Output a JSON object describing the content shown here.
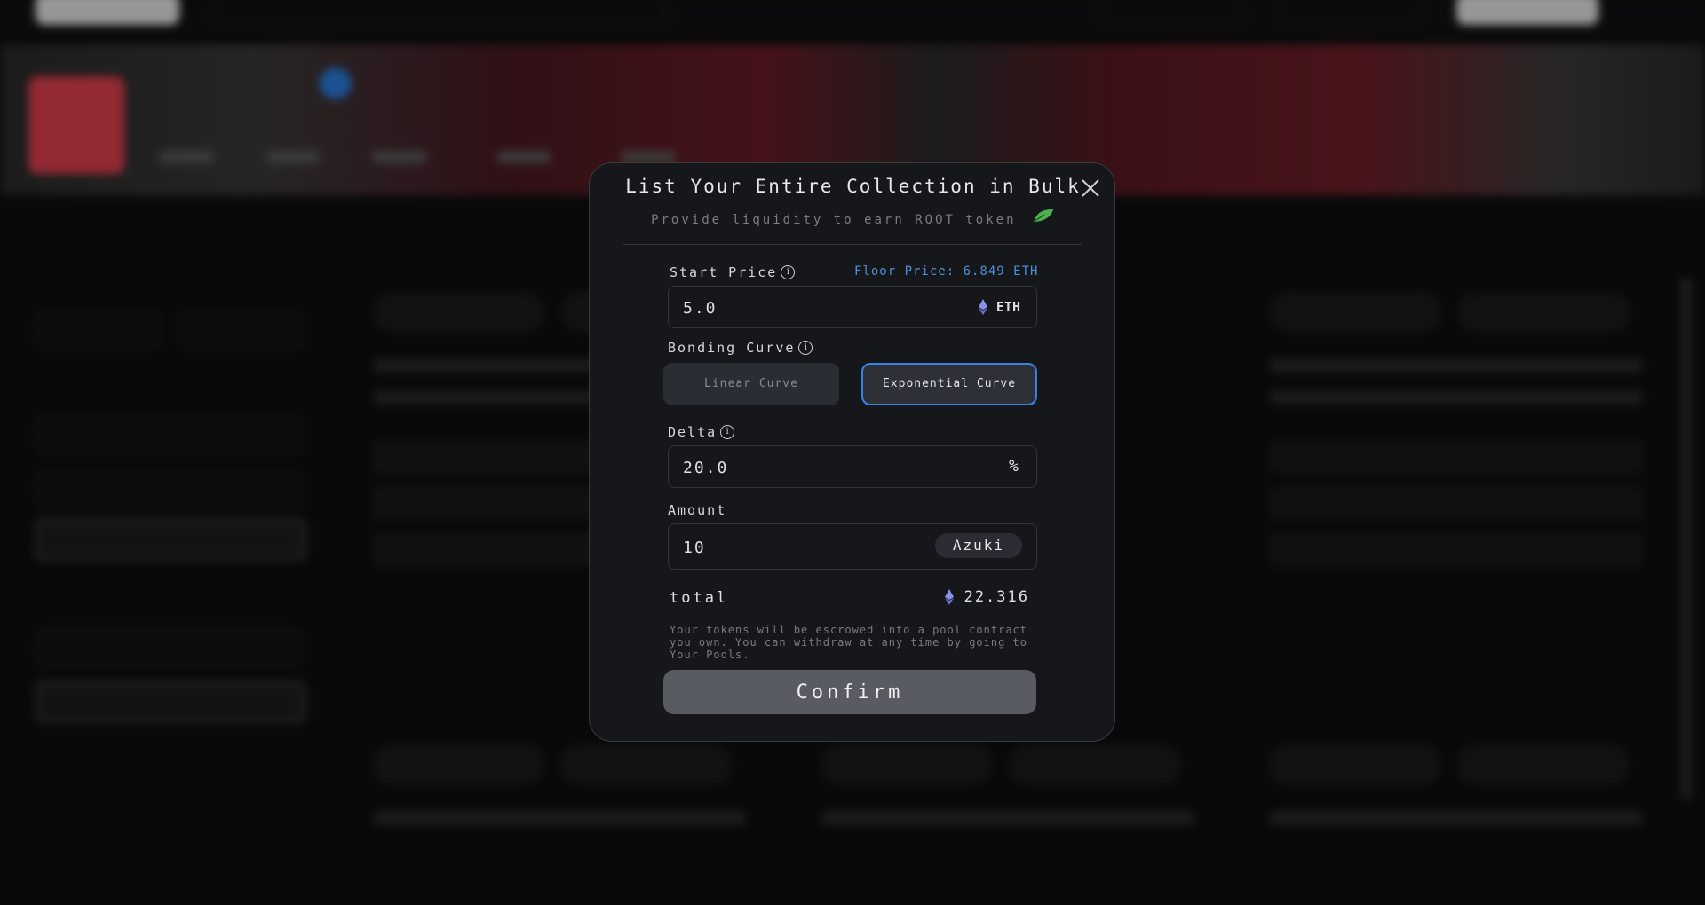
{
  "modal": {
    "title": "List Your Entire Collection in Bulk",
    "subtitle": "Provide liquidity to earn ROOT token",
    "leaf_icon": "leaf-icon",
    "close_icon": "close-icon",
    "start_price": {
      "label": "Start Price",
      "info_icon": "info-icon",
      "floor_label": "Floor Price: 6.849 ETH",
      "value": "5.0",
      "unit": "ETH",
      "unit_icon": "ethereum-icon"
    },
    "bonding_curve": {
      "label": "Bonding Curve",
      "options": [
        "Linear Curve",
        "Exponential Curve"
      ],
      "selected": "Exponential Curve"
    },
    "delta": {
      "label": "Delta",
      "value": "20.0",
      "unit": "%"
    },
    "amount": {
      "label": "Amount",
      "value": "10",
      "token": "Azuki"
    },
    "total": {
      "label": "total",
      "value": "22.316",
      "unit_icon": "ethereum-icon"
    },
    "note": "Your tokens will be escrowed into a pool contract you own. You can withdraw at any time by going to Your Pools.",
    "confirm_label": "Confirm"
  },
  "colors": {
    "accent_blue": "#3b82e6",
    "floor_price_blue": "#4f8fd8",
    "confirm_bg": "#595b63",
    "modal_bg": "#16171b"
  }
}
